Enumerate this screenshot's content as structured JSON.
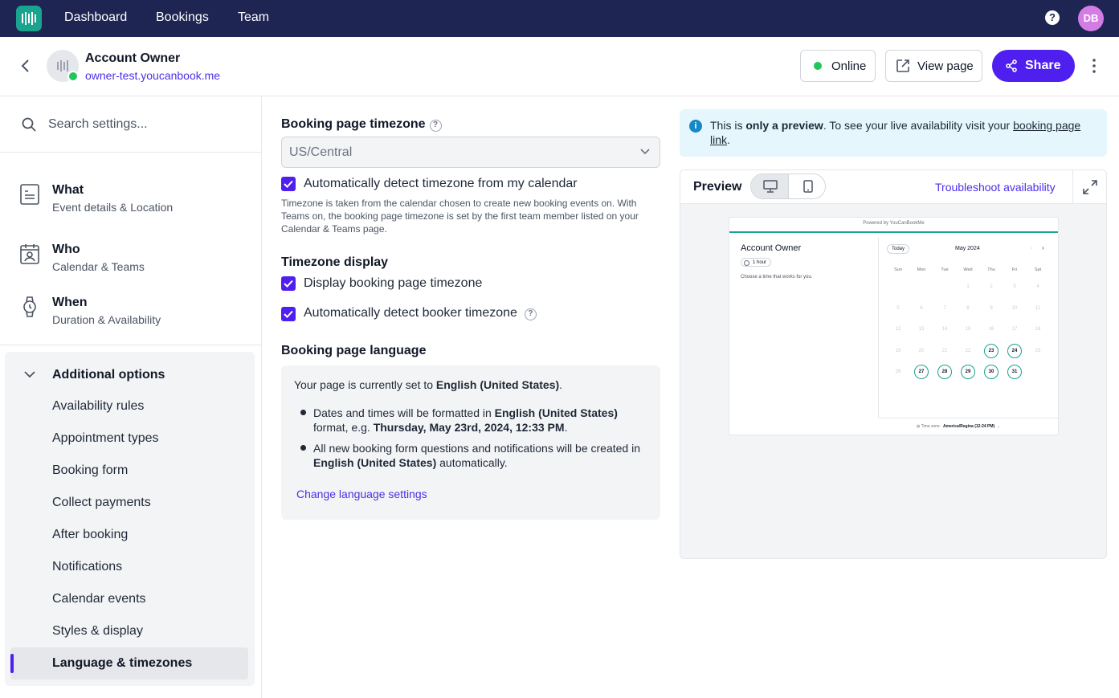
{
  "nav": {
    "links": [
      "Dashboard",
      "Bookings",
      "Team"
    ],
    "help": "?",
    "avatar_initials": "DB"
  },
  "header": {
    "account_name": "Account Owner",
    "account_url": "owner-test.youcanbook.me",
    "status_label": "Online",
    "view_label": "View page",
    "share_label": "Share"
  },
  "sidebar": {
    "search_placeholder": "Search settings...",
    "sections": [
      {
        "title": "What",
        "subtitle": "Event details & Location",
        "icon": "document-icon"
      },
      {
        "title": "Who",
        "subtitle": "Calendar & Teams",
        "icon": "calendar-person-icon"
      },
      {
        "title": "When",
        "subtitle": "Duration & Availability",
        "icon": "watch-icon"
      }
    ],
    "additional_title": "Additional options",
    "additional_items": [
      "Availability rules",
      "Appointment types",
      "Booking form",
      "Collect payments",
      "After booking",
      "Notifications",
      "Calendar events",
      "Styles & display",
      "Language & timezones"
    ],
    "active_item": "Language & timezones"
  },
  "main": {
    "tz_heading": "Booking page timezone",
    "tz_value": "US/Central",
    "auto_detect_label": "Automatically detect timezone from my calendar",
    "auto_detect_help": "Timezone is taken from the calendar chosen to create new booking events on. With Teams on, the booking page timezone is set by the first team member listed on your Calendar & Teams page.",
    "display_heading": "Timezone display",
    "display_label": "Display booking page timezone",
    "booker_label": "Automatically detect booker timezone",
    "lang_heading": "Booking page language",
    "lang_intro": "Your page is currently set to",
    "lang_value": "English (United States)",
    "bullet1_a": "Dates and times will be formatted in",
    "bullet1_b": "format, e.g.",
    "bullet1_example": "Thursday, May 23rd, 2024, 12:33 PM",
    "bullet2_a": "All new booking form questions and notifications will be created in",
    "bullet2_b": "automatically.",
    "change_link": "Change language settings"
  },
  "info": {
    "text_a": "This is",
    "text_bold": "only a preview",
    "text_b": ". To see your live availability visit your",
    "link": "booking page link",
    "text_c": "."
  },
  "preview": {
    "title": "Preview",
    "troubleshoot": "Troubleshoot availability",
    "mini": {
      "powered": "Powered by YouCanBookMe",
      "name": "Account Owner",
      "duration": "1 hour",
      "choose": "Choose a time that works for you.",
      "today": "Today",
      "month": "May 2024",
      "days": [
        "Sun",
        "Mon",
        "Tue",
        "Wed",
        "Thu",
        "Fri",
        "Sat"
      ],
      "weeks": [
        [
          "",
          "",
          "",
          "1",
          "2",
          "3",
          "4"
        ],
        [
          "5",
          "6",
          "7",
          "8",
          "9",
          "10",
          "11"
        ],
        [
          "12",
          "13",
          "14",
          "15",
          "16",
          "17",
          "18"
        ],
        [
          "19",
          "20",
          "21",
          "22",
          "23",
          "24",
          "25"
        ],
        [
          "26",
          "27",
          "28",
          "29",
          "30",
          "31",
          ""
        ]
      ],
      "available": [
        "23",
        "24",
        "27",
        "28",
        "29",
        "30",
        "31"
      ],
      "tz_label": "Time zone",
      "tz_value": "America/Regina (12:24 PM)"
    }
  },
  "colors": {
    "nav_bg": "#1e2552",
    "accent": "#4f1ff0",
    "brand_green": "#1aa38f",
    "online_green": "#22c55e",
    "info_bg": "#e5f6fd"
  }
}
